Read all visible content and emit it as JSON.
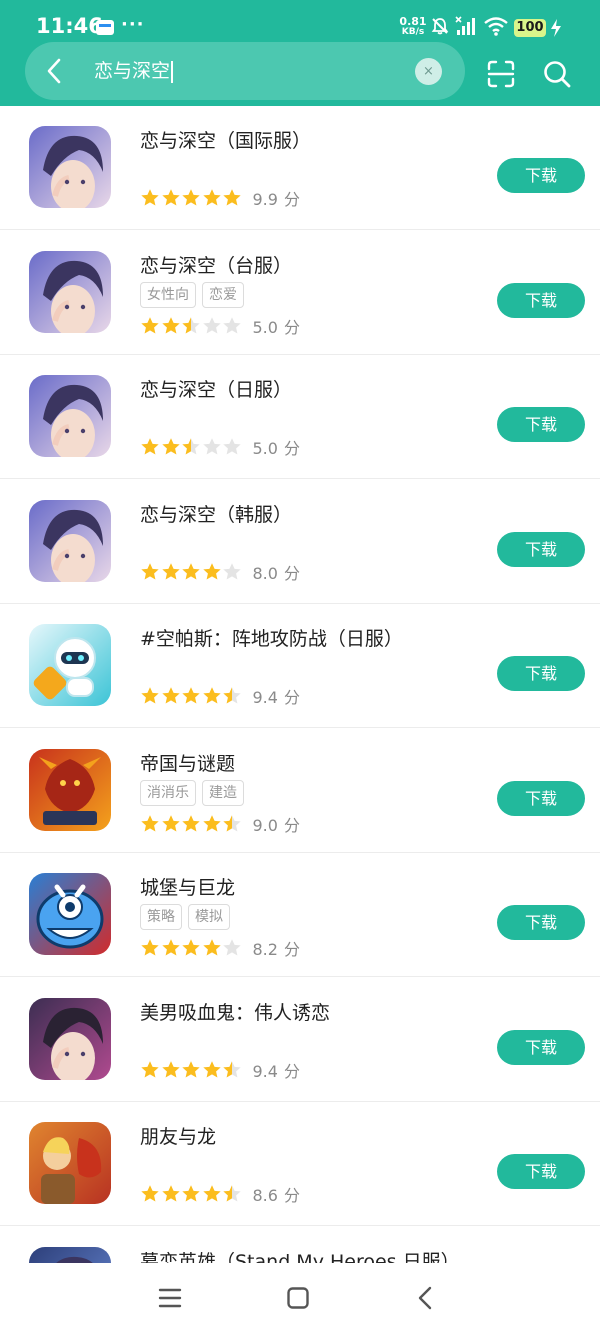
{
  "status_bar": {
    "time": "11:46",
    "dots": "···",
    "net_speed_value": "0.81",
    "net_speed_unit": "KB/s",
    "battery": "100"
  },
  "search": {
    "query": "恋与深空",
    "clear_icon": "×"
  },
  "download_label": "下载",
  "score_unit": "分",
  "apps": [
    {
      "name": "恋与深空（国际服）",
      "tags": [],
      "stars": 5,
      "score": "9.9",
      "icon": "anime-boy-portrait",
      "colors": [
        "#6a6cc9",
        "#e8d7e8"
      ]
    },
    {
      "name": "恋与深空（台服）",
      "tags": [
        "女性向",
        "恋爱"
      ],
      "stars": 2.5,
      "score": "5.0",
      "icon": "anime-boy-portrait",
      "colors": [
        "#6a6cc9",
        "#e8d7e8"
      ]
    },
    {
      "name": "恋与深空（日服）",
      "tags": [],
      "stars": 2.5,
      "score": "5.0",
      "icon": "anime-boy-portrait",
      "colors": [
        "#6a6cc9",
        "#e8d7e8"
      ]
    },
    {
      "name": "恋与深空（韩服）",
      "tags": [],
      "stars": 4,
      "score": "8.0",
      "icon": "anime-boy-portrait",
      "colors": [
        "#6a6cc9",
        "#e8d7e8"
      ]
    },
    {
      "name": "#空帕斯：阵地攻防战（日服）",
      "tags": [],
      "stars": 4.5,
      "score": "9.4",
      "icon": "robot-mascot",
      "colors": [
        "#e6f7fb",
        "#3cc4d6"
      ]
    },
    {
      "name": "帝国与谜题",
      "tags": [
        "消消乐",
        "建造"
      ],
      "stars": 4.5,
      "score": "9.0",
      "icon": "red-dragon",
      "colors": [
        "#c8321c",
        "#f4a21c"
      ]
    },
    {
      "name": "城堡与巨龙",
      "tags": [
        "策略",
        "模拟"
      ],
      "stars": 4,
      "score": "8.2",
      "icon": "blue-monster",
      "colors": [
        "#2a7fd4",
        "#d12b2b"
      ]
    },
    {
      "name": "美男吸血鬼：伟人诱恋",
      "tags": [],
      "stars": 4.5,
      "score": "9.4",
      "icon": "vampire-man",
      "colors": [
        "#3c2e52",
        "#b04a8f"
      ]
    },
    {
      "name": "朋友与龙",
      "tags": [],
      "stars": 4.5,
      "score": "8.6",
      "icon": "hero-and-dragon",
      "colors": [
        "#e0852f",
        "#b83222"
      ]
    },
    {
      "name": "幕恋英雄（Stand My Heroes 日服）",
      "tags": [],
      "stars": 0,
      "score": "",
      "icon": "anime-hero",
      "colors": [
        "#2d3f7a",
        "#6a8bd6"
      ]
    }
  ],
  "colors": {
    "accent": "#22b99c",
    "star_on": "#fbbd1e",
    "star_off": "#e4e4e4"
  }
}
